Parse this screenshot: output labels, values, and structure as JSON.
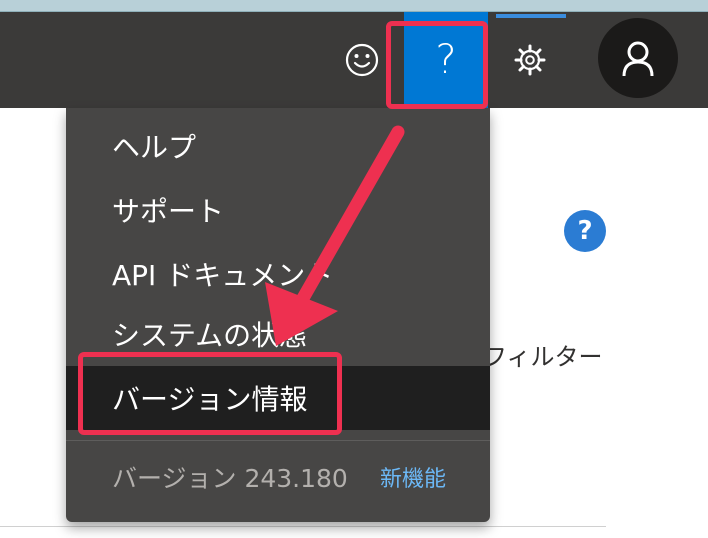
{
  "header": {
    "icons": [
      "smiley-icon",
      "help-icon",
      "gear-icon",
      "person-icon"
    ],
    "help_glyph": "?",
    "colors": {
      "bar": "#3b3a39",
      "help_active": "#0078d4",
      "avatar": "#1b1a19"
    }
  },
  "help_menu": {
    "items": [
      {
        "label": "ヘルプ"
      },
      {
        "label": "サポート"
      },
      {
        "label": "API ドキュメント"
      },
      {
        "label": "システムの状態"
      },
      {
        "label": "バージョン情報",
        "selected": true
      }
    ],
    "version_label": "バージョン 243.180",
    "whats_new": "新機能",
    "colors": {
      "menu_bg": "#474645",
      "selected_bg": "#1f1f1f",
      "link": "#6cb8f6"
    }
  },
  "content": {
    "help_glyph": "?",
    "filter_text": "フィルター"
  },
  "annotation": {
    "color": "#ee3050"
  }
}
